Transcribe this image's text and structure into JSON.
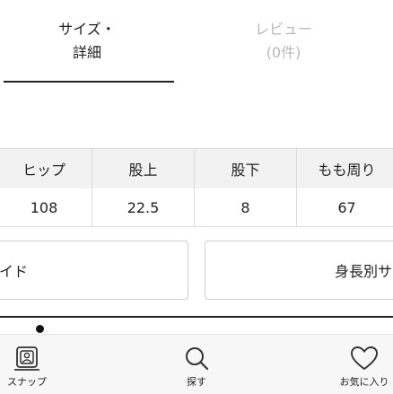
{
  "tabs": [
    {
      "line1": "サイズ・",
      "line2": "詳細"
    },
    {
      "line1": "レビュー",
      "line2": "(0件)"
    }
  ],
  "size_table": {
    "headers": [
      "ヒップ",
      "股上",
      "股下",
      "もも周り"
    ],
    "values": [
      "108",
      "22.5",
      "8",
      "67"
    ]
  },
  "buttons": {
    "left_label": "イド",
    "right_label": "身長別サ"
  },
  "bottom_nav": {
    "snap_label": "スナップ",
    "search_label": "探す",
    "favorite_label": "お気に入り"
  },
  "colors": {
    "active": "#222222",
    "inactive": "#b9b9b9",
    "header_bg": "#f2f2f2"
  }
}
